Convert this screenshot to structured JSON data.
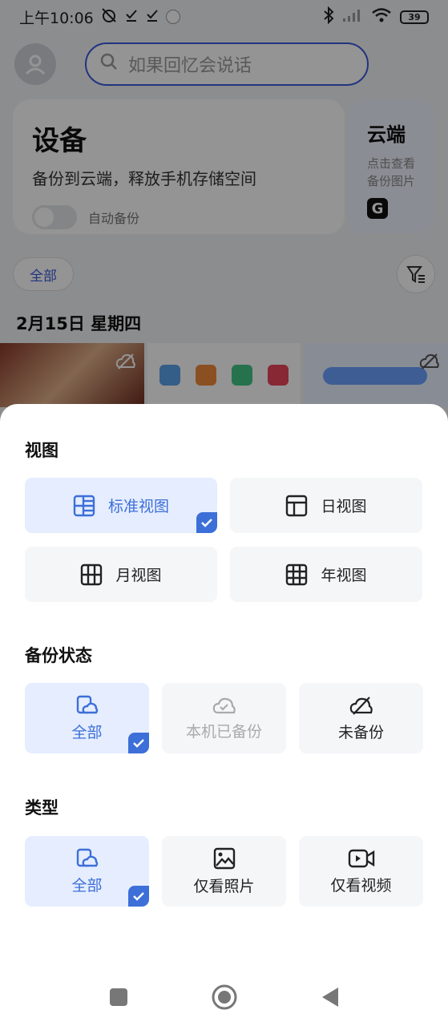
{
  "status_bar": {
    "time": "上午10:06",
    "battery": "39"
  },
  "header": {
    "search_placeholder": "如果回忆会说话"
  },
  "device_card": {
    "title": "设备",
    "subtitle": "备份到云端，释放手机存储空间",
    "auto_backup_label": "自动备份",
    "auto_backup_on": false
  },
  "cloud_card": {
    "title": "云端",
    "line1": "点击查看",
    "line2": "备份图片"
  },
  "filter": {
    "chip_label": "全部"
  },
  "gallery": {
    "date_heading": "2月15日 星期四"
  },
  "sheet": {
    "view_section": {
      "title": "视图",
      "options": [
        {
          "label": "标准视图",
          "icon": "standard-view-icon",
          "selected": true
        },
        {
          "label": "日视图",
          "icon": "day-view-icon",
          "selected": false
        },
        {
          "label": "月视图",
          "icon": "month-view-icon",
          "selected": false
        },
        {
          "label": "年视图",
          "icon": "year-view-icon",
          "selected": false
        }
      ]
    },
    "backup_section": {
      "title": "备份状态",
      "options": [
        {
          "label": "全部",
          "icon": "all-icon",
          "selected": true
        },
        {
          "label": "本机已备份",
          "icon": "cloud-backed-up-icon",
          "selected": false,
          "disabled": true
        },
        {
          "label": "未备份",
          "icon": "not-backed-up-icon",
          "selected": false
        }
      ]
    },
    "type_section": {
      "title": "类型",
      "options": [
        {
          "label": "全部",
          "icon": "all-icon",
          "selected": true
        },
        {
          "label": "仅看照片",
          "icon": "photo-icon",
          "selected": false
        },
        {
          "label": "仅看视频",
          "icon": "video-icon",
          "selected": false
        }
      ]
    }
  },
  "colors": {
    "accent": "#3d6fd8",
    "selected_bg": "#e5edff",
    "option_bg": "#f5f6f8"
  }
}
